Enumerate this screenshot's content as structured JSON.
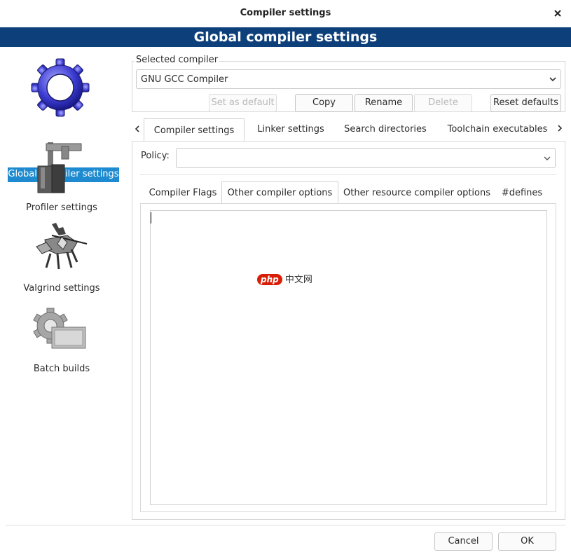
{
  "window": {
    "title": "Compiler settings"
  },
  "header": {
    "title": "Global compiler settings"
  },
  "categories": [
    {
      "label": "Global compiler settings",
      "icon": "gear-icon"
    },
    {
      "label": "Profiler settings",
      "icon": "caliper-icon"
    },
    {
      "label": "Valgrind settings",
      "icon": "knight-icon"
    },
    {
      "label": "Batch builds",
      "icon": "gear-box-icon"
    }
  ],
  "compiler": {
    "section_label": "Selected compiler",
    "selected": "GNU GCC Compiler",
    "buttons": {
      "set_default": "Set as default",
      "copy": "Copy",
      "rename": "Rename",
      "delete": "Delete",
      "reset": "Reset defaults"
    }
  },
  "tabs": [
    "Compiler settings",
    "Linker settings",
    "Search directories",
    "Toolchain executables"
  ],
  "policy": {
    "label": "Policy:",
    "value": ""
  },
  "subtabs": [
    "Compiler Flags",
    "Other compiler options",
    "Other resource compiler options",
    "#defines"
  ],
  "editor": {
    "text": ""
  },
  "watermark": {
    "badge": "php",
    "text": "中文网"
  },
  "footer": {
    "cancel": "Cancel",
    "ok": "OK"
  },
  "colors": {
    "header_bg": "#0d3f7a",
    "selection": "#1e8bd0"
  }
}
